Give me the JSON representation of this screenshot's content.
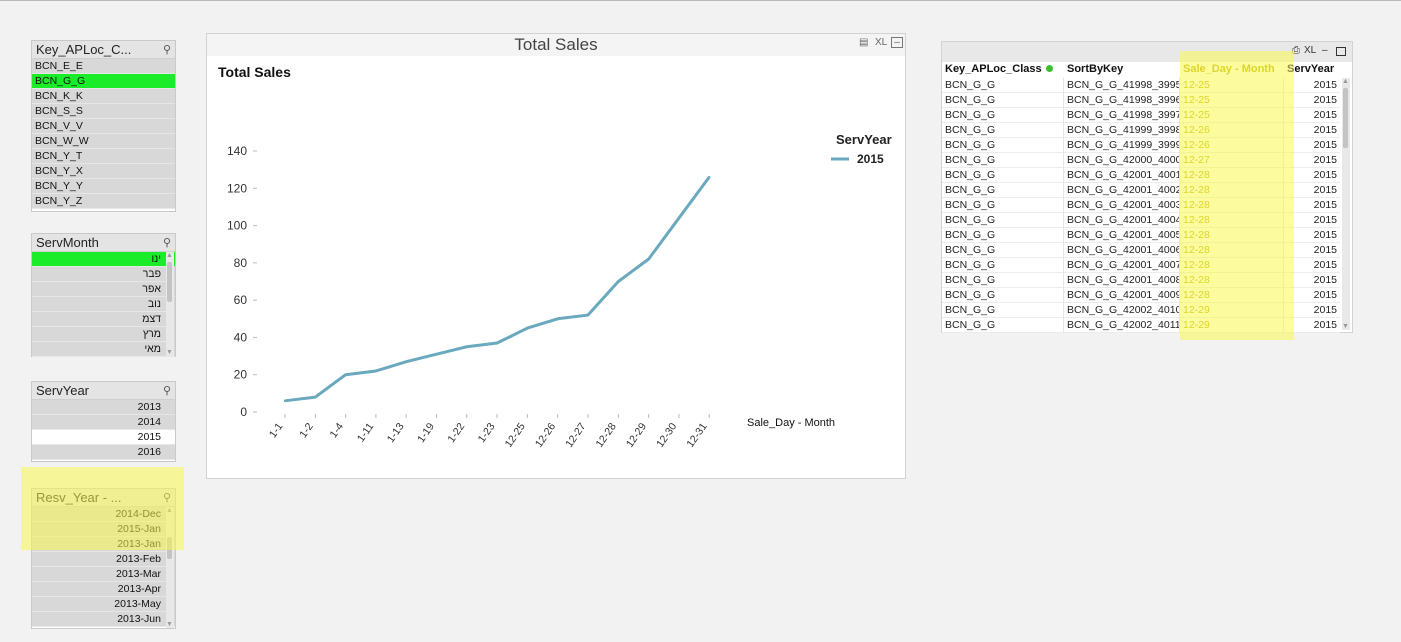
{
  "key_aploc": {
    "title": "Key_APLoc_C...",
    "items": [
      "BCN_E_E",
      "BCN_G_G",
      "BCN_K_K",
      "BCN_S_S",
      "BCN_V_V",
      "BCN_W_W",
      "BCN_Y_T",
      "BCN_Y_X",
      "BCN_Y_Y",
      "BCN_Y_Z"
    ],
    "selected": "BCN_G_G"
  },
  "serv_month": {
    "title": "ServMonth",
    "items": [
      "ינו",
      "פבר",
      "אפר",
      "נוב",
      "דצמ",
      "מרץ",
      "מאי"
    ],
    "selected": "ינו"
  },
  "serv_year": {
    "title": "ServYear",
    "items": [
      "2013",
      "2014",
      "2015",
      "2016"
    ],
    "selected": "2015"
  },
  "resv_year": {
    "title": "Resv_Year - ...",
    "items": [
      "2014-Dec",
      "2015-Jan",
      "2013-Jan",
      "2013-Feb",
      "2013-Mar",
      "2013-Apr",
      "2013-May",
      "2013-Jun"
    ]
  },
  "chart": {
    "caption": "Total Sales",
    "xl_label": "XL"
  },
  "chart_data": {
    "type": "line",
    "title": "Total Sales",
    "xlabel": "Sale_Day - Month",
    "ylabel": "",
    "ylim": [
      0,
      140
    ],
    "yticks": [
      0,
      20,
      40,
      60,
      80,
      100,
      120,
      140
    ],
    "grid": false,
    "legend_title": "ServYear",
    "legend_position": "right",
    "categories": [
      "1-1",
      "1-2",
      "1-4",
      "1-11",
      "1-13",
      "1-19",
      "1-22",
      "1-23",
      "12-25",
      "12-26",
      "12-27",
      "12-28",
      "12-29",
      "12-30",
      "12-31"
    ],
    "series": [
      {
        "name": "2015",
        "color": "#6aa9bd",
        "values": [
          6,
          8,
          20,
          22,
          27,
          31,
          35,
          37,
          45,
          50,
          52,
          70,
          82,
          104,
          126
        ]
      }
    ]
  },
  "table": {
    "columns": [
      "Key_APLoc_Class",
      "SortByKey",
      "Sale_Day - Month",
      "ServYear"
    ],
    "rows": [
      [
        "BCN_G_G",
        "BCN_G_G_41998_3995",
        "12-25",
        "2015"
      ],
      [
        "BCN_G_G",
        "BCN_G_G_41998_3996",
        "12-25",
        "2015"
      ],
      [
        "BCN_G_G",
        "BCN_G_G_41998_3997",
        "12-25",
        "2015"
      ],
      [
        "BCN_G_G",
        "BCN_G_G_41999_3998",
        "12-26",
        "2015"
      ],
      [
        "BCN_G_G",
        "BCN_G_G_41999_3999",
        "12-26",
        "2015"
      ],
      [
        "BCN_G_G",
        "BCN_G_G_42000_4000",
        "12-27",
        "2015"
      ],
      [
        "BCN_G_G",
        "BCN_G_G_42001_4001",
        "12-28",
        "2015"
      ],
      [
        "BCN_G_G",
        "BCN_G_G_42001_4002",
        "12-28",
        "2015"
      ],
      [
        "BCN_G_G",
        "BCN_G_G_42001_4003",
        "12-28",
        "2015"
      ],
      [
        "BCN_G_G",
        "BCN_G_G_42001_4004",
        "12-28",
        "2015"
      ],
      [
        "BCN_G_G",
        "BCN_G_G_42001_4005",
        "12-28",
        "2015"
      ],
      [
        "BCN_G_G",
        "BCN_G_G_42001_4006",
        "12-28",
        "2015"
      ],
      [
        "BCN_G_G",
        "BCN_G_G_42001_4007",
        "12-28",
        "2015"
      ],
      [
        "BCN_G_G",
        "BCN_G_G_42001_4008",
        "12-28",
        "2015"
      ],
      [
        "BCN_G_G",
        "BCN_G_G_42001_4009",
        "12-28",
        "2015"
      ],
      [
        "BCN_G_G",
        "BCN_G_G_42002_4010",
        "12-29",
        "2015"
      ],
      [
        "BCN_G_G",
        "BCN_G_G_42002_4011",
        "12-29",
        "2015"
      ]
    ],
    "xl_label": "XL"
  },
  "colors": {
    "selected": "#1aec2a",
    "highlight": "#fafa50",
    "line": "#6aa9bd"
  }
}
